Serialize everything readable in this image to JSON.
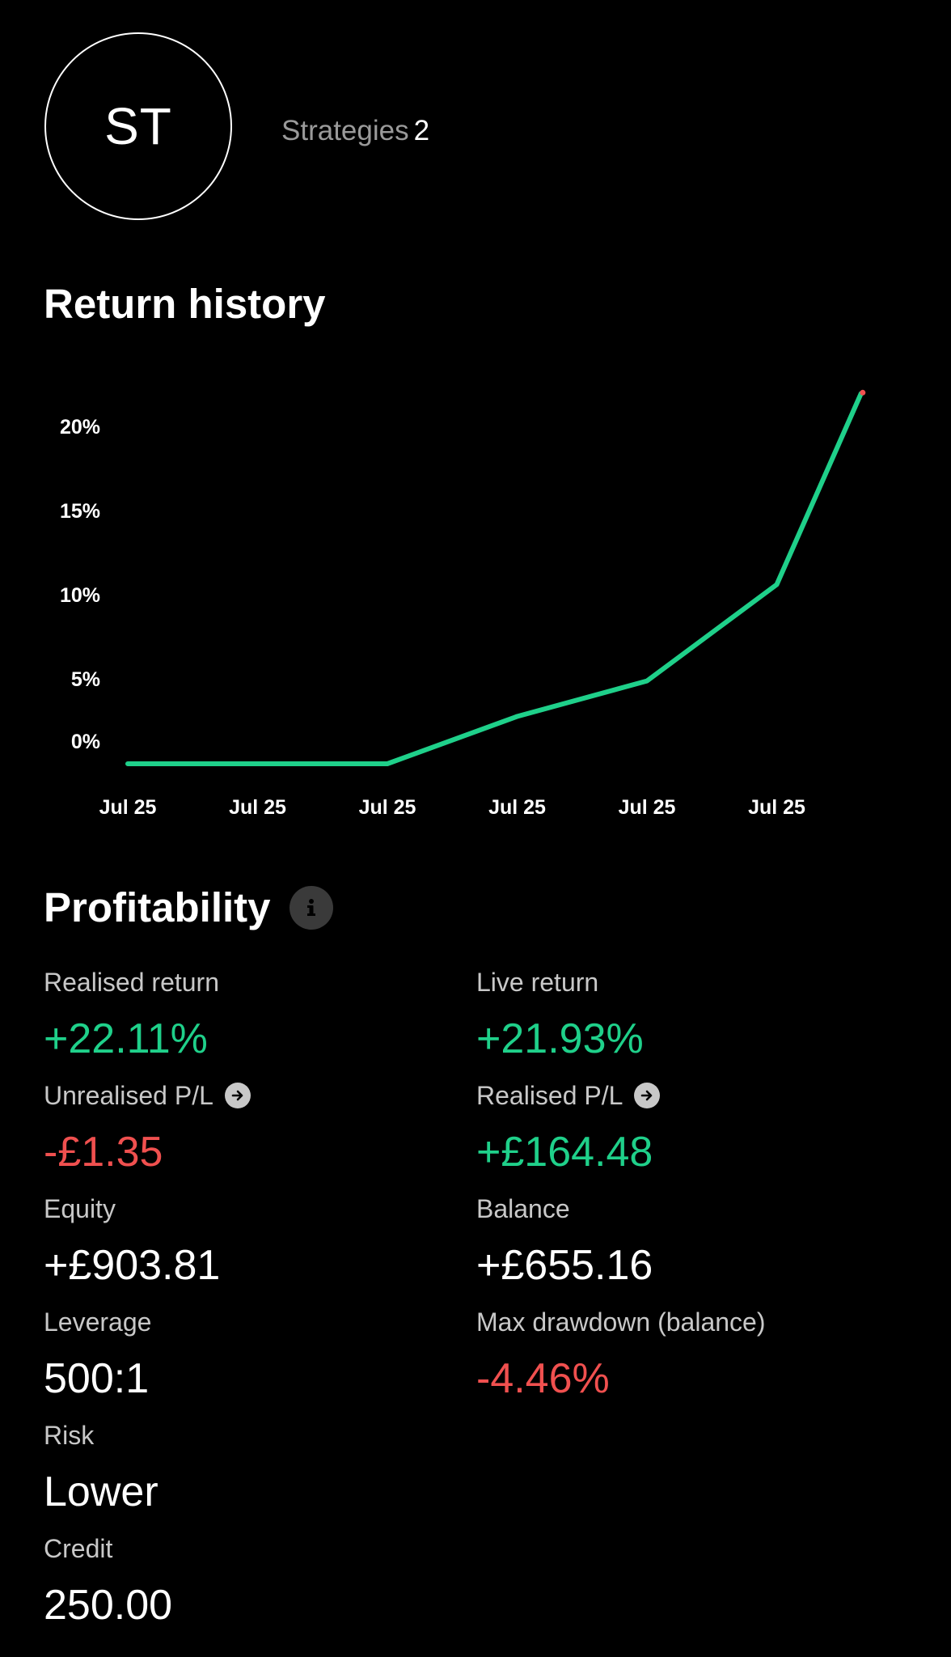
{
  "profile": {
    "initials": "ST",
    "strategies_label": "Strategies",
    "strategies_count": "2"
  },
  "return_history": {
    "title": "Return history"
  },
  "chart_data": {
    "type": "line",
    "title": "",
    "xlabel": "",
    "ylabel": "",
    "y_ticks": [
      {
        "value": 20,
        "label": "20%"
      },
      {
        "value": 15,
        "label": "15%"
      },
      {
        "value": 10,
        "label": "10%"
      },
      {
        "value": 5,
        "label": "5%"
      },
      {
        "value": 0,
        "label": "0%"
      }
    ],
    "x_tick_labels": [
      "Jul 25",
      "Jul 25",
      "Jul 25",
      "Jul 25",
      "Jul 25",
      "Jul 25"
    ],
    "ylim": [
      0,
      22
    ],
    "grid": false,
    "line_color": "#1fd08a",
    "endpoint_color": "#f0504f",
    "series": [
      {
        "x": [
          0,
          1,
          2,
          3,
          4,
          5,
          5.65
        ],
        "values": [
          0,
          0,
          0,
          2.8,
          4.9,
          10.6,
          21.9
        ]
      }
    ]
  },
  "profitability": {
    "title": "Profitability",
    "info_icon": "info-icon",
    "metrics": {
      "realised_return": {
        "label": "Realised return",
        "value": "+22.11%"
      },
      "live_return": {
        "label": "Live return",
        "value": "+21.93%"
      },
      "unrealised_pl": {
        "label": "Unrealised P/L",
        "value": "-£1.35",
        "icon": "arrow-right-circle-icon"
      },
      "realised_pl": {
        "label": "Realised P/L",
        "value": "+£164.48",
        "icon": "arrow-right-circle-icon"
      },
      "equity": {
        "label": "Equity",
        "value": "+£903.81"
      },
      "balance": {
        "label": "Balance",
        "value": "+£655.16"
      },
      "leverage": {
        "label": "Leverage",
        "value": "500:1"
      },
      "max_drawdown": {
        "label": "Max drawdown (balance)",
        "value": "-4.46%"
      },
      "risk": {
        "label": "Risk",
        "value": "Lower"
      },
      "credit": {
        "label": "Credit",
        "value": "250.00"
      }
    }
  },
  "colors": {
    "positive": "#1fd08a",
    "negative": "#f0504f",
    "background": "#000000",
    "text": "#ffffff",
    "muted": "#c8c8c8"
  }
}
